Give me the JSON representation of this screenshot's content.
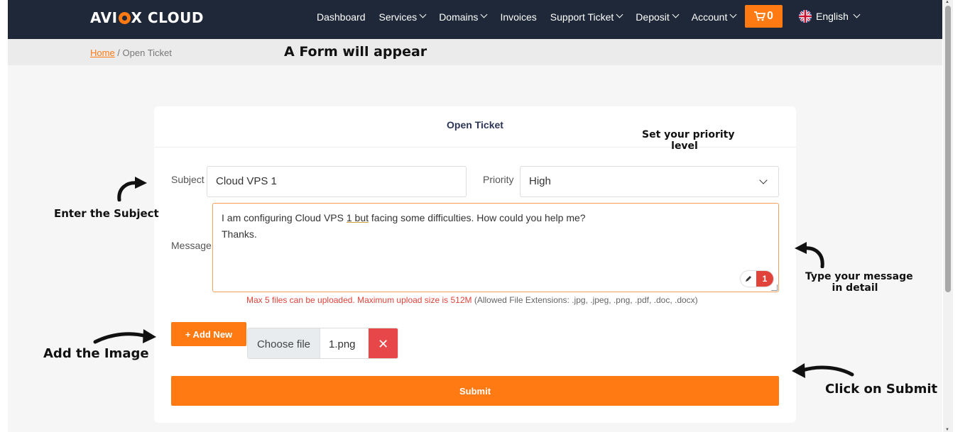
{
  "navbar": {
    "logo": "AVI",
    "logo_rest": "X CLOUD",
    "items": [
      {
        "label": "Dashboard",
        "dropdown": false
      },
      {
        "label": "Services",
        "dropdown": true
      },
      {
        "label": "Domains",
        "dropdown": true
      },
      {
        "label": "Invoices",
        "dropdown": false
      },
      {
        "label": "Support Ticket",
        "dropdown": true
      },
      {
        "label": "Deposit",
        "dropdown": true
      },
      {
        "label": "Account",
        "dropdown": true
      }
    ],
    "cart_count": "0",
    "language": "English",
    "cart_icon": "cart-icon",
    "flag_icon": "uk-flag-icon"
  },
  "breadcrumb": {
    "home": "Home",
    "separator": " / ",
    "current": "Open Ticket"
  },
  "form": {
    "title": "Open Ticket",
    "subject_label": "Subject",
    "subject_value": "Cloud VPS 1",
    "priority_label": "Priority",
    "priority_value": "High",
    "message_label": "Message",
    "message_line1_a": "I am configuring Cloud VPS ",
    "message_line1_b": "1 but",
    "message_line1_c": " facing some difficulties. How could you help me?",
    "message_line2": "Thanks.",
    "widget_count": "1",
    "upload_hint_red": "Max 5 files can be uploaded. Maximum upload size is 512M",
    "upload_hint_grey": " (Allowed File Extensions: .jpg, .jpeg, .png, .pdf, .doc, .docx)",
    "add_new_label": "+ Add New",
    "choose_file_label": "Choose file",
    "file_name": "1.png",
    "remove_label": "✕",
    "submit_label": "Submit"
  },
  "annotations": {
    "form_appear": "A Form will appear",
    "priority_1": "Set your priority",
    "priority_2": "level",
    "subject": "Enter the Subject",
    "message_1": "Type your message",
    "message_2": "in detail",
    "image": "Add the Image",
    "submit": "Click on Submit"
  },
  "colors": {
    "navbar_bg": "#1e2838",
    "accent": "#ff7a12",
    "danger": "#e8474a"
  }
}
